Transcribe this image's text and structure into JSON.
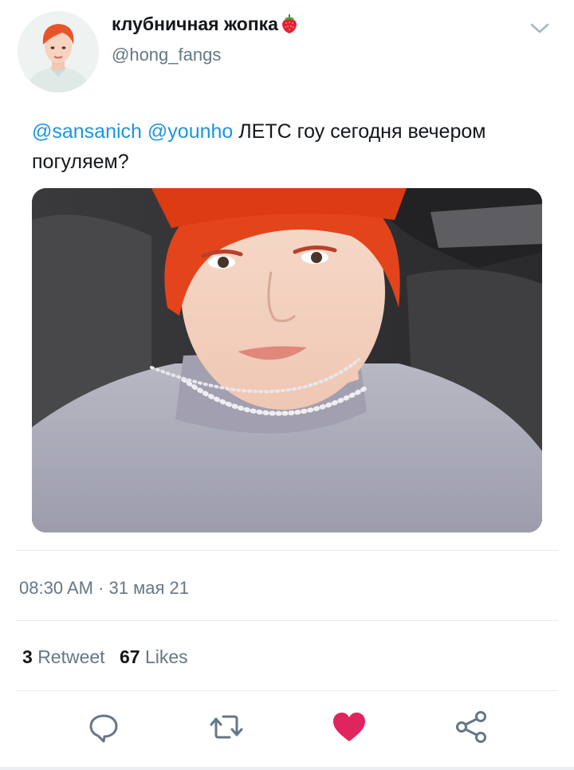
{
  "author": {
    "display_name": "клубничная жопка",
    "emoji": "strawberry-emoji",
    "handle": "@hong_fangs",
    "avatar": "avatar-photo"
  },
  "tweet": {
    "mention_1": "@sansanich",
    "mention_2": "@younho",
    "text": "ЛЕТС гоу сегодня вечером погуляем?",
    "media": "selfie-photo"
  },
  "meta": {
    "time": "08:30 AM",
    "separator": "·",
    "date": "31 мая 21"
  },
  "stats": {
    "retweets_count": "3",
    "retweets_label": "Retweet",
    "likes_count": "67",
    "likes_label": "Likes"
  },
  "actions": {
    "reply_icon": "speech-bubble-icon",
    "retweet_icon": "retweet-icon",
    "like_icon": "heart-icon",
    "share_icon": "share-icon"
  },
  "colors": {
    "link": "#1b95e0",
    "secondary_text": "#657786",
    "like_active": "#e0245e",
    "icon": "#657786",
    "divider": "#e6ecf0"
  }
}
